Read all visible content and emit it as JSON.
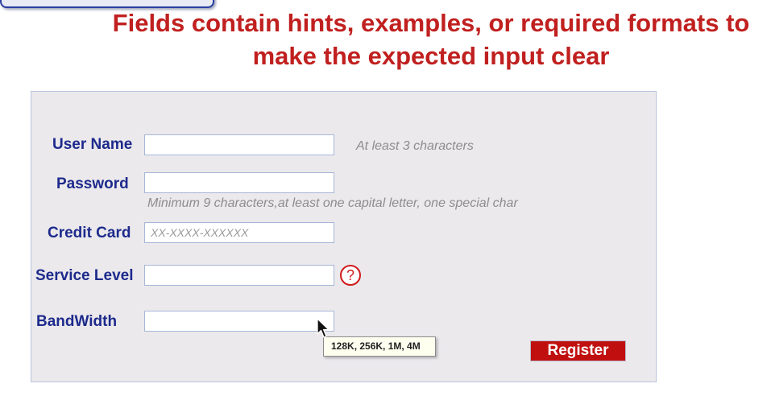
{
  "headline": {
    "line1": "Fields contain hints, examples, or required formats to",
    "line2": "make the expected input clear"
  },
  "form": {
    "username": {
      "label": "User Name",
      "value": "",
      "hint": "At least 3 characters"
    },
    "password": {
      "label": "Password",
      "value": "",
      "hint": "Minimum 9 characters,at least one capital letter, one special char"
    },
    "credit_card": {
      "label": "Credit Card",
      "value": "",
      "placeholder": "XX-XXXX-XXXXXX"
    },
    "service_level": {
      "label": "Service Level",
      "value": "",
      "help_icon": "?"
    },
    "bandwidth": {
      "label": "BandWidth",
      "value": "",
      "tooltip": "128K, 256K, 1M, 4M"
    },
    "register_label": "Register"
  },
  "colors": {
    "headline": "#c0201f",
    "label": "#1d2a8c",
    "panel": "#ebe9ec",
    "button": "#c00f0f",
    "help_icon": "#d01c1c"
  },
  "icons": {
    "help": "help-icon",
    "cursor": "mouse-cursor-icon"
  }
}
